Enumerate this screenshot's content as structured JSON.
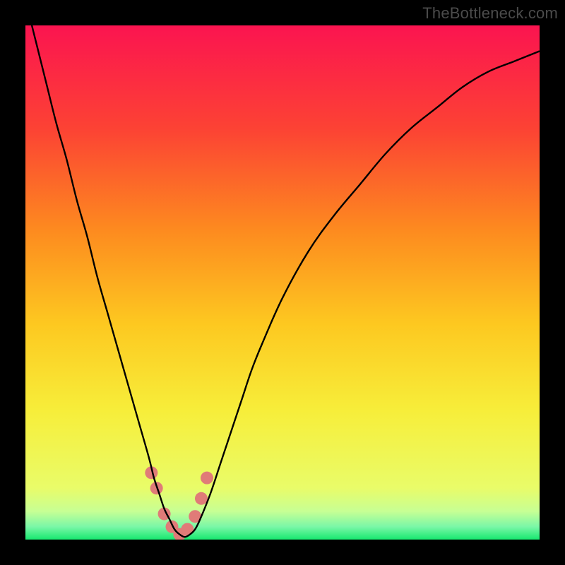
{
  "watermark": "TheBottleneck.com",
  "chart_data": {
    "type": "line",
    "title": "",
    "xlabel": "",
    "ylabel": "",
    "xlim": [
      0,
      100
    ],
    "ylim": [
      0,
      100
    ],
    "grid": false,
    "series": [
      {
        "name": "curve",
        "x": [
          0,
          2,
          4,
          6,
          8,
          10,
          12,
          14,
          16,
          18,
          20,
          22,
          24,
          25,
          26,
          27,
          28,
          29,
          30,
          31,
          32,
          33,
          34,
          36,
          38,
          40,
          42,
          44,
          46,
          50,
          55,
          60,
          65,
          70,
          75,
          80,
          85,
          90,
          95,
          100
        ],
        "y": [
          105,
          97,
          89,
          81,
          74,
          66,
          59,
          51,
          44,
          37,
          30,
          23,
          16,
          12,
          9,
          6,
          4,
          2,
          1,
          0.5,
          1,
          2,
          4,
          9,
          15,
          21,
          27,
          33,
          38,
          47,
          56,
          63,
          69,
          75,
          80,
          84,
          88,
          91,
          93,
          95
        ]
      }
    ],
    "markers": {
      "comment": "pink dots near the trough",
      "x": [
        24.5,
        25.5,
        27.0,
        28.5,
        30.0,
        31.5,
        33.0,
        34.2,
        35.3
      ],
      "y": [
        13,
        10,
        5,
        2.5,
        1,
        2,
        4.5,
        8,
        12
      ],
      "color": "#e07b78",
      "radius_px": 9
    },
    "background_gradient": {
      "stops": [
        {
          "pos": 0.0,
          "color": "#fb1450"
        },
        {
          "pos": 0.2,
          "color": "#fc4234"
        },
        {
          "pos": 0.4,
          "color": "#fd8b1f"
        },
        {
          "pos": 0.58,
          "color": "#fdc820"
        },
        {
          "pos": 0.75,
          "color": "#f7ee3a"
        },
        {
          "pos": 0.9,
          "color": "#e9fc69"
        },
        {
          "pos": 0.945,
          "color": "#c7ff94"
        },
        {
          "pos": 0.975,
          "color": "#7af7a7"
        },
        {
          "pos": 1.0,
          "color": "#17e86f"
        }
      ]
    }
  }
}
